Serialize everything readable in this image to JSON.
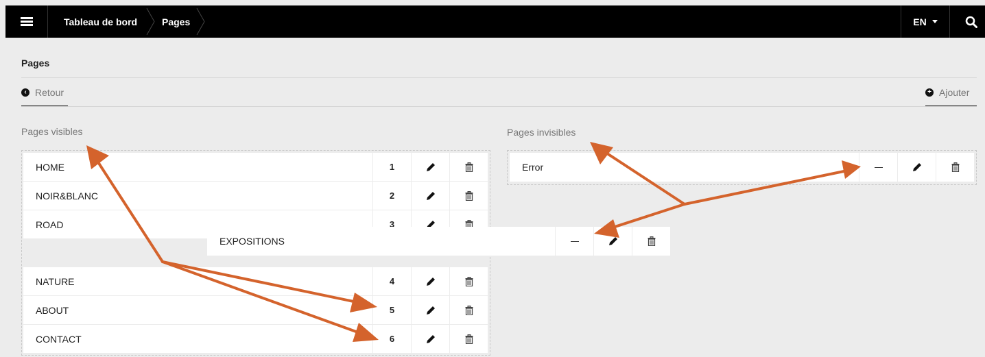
{
  "topbar": {
    "breadcrumb": [
      {
        "label": "Tableau de bord"
      },
      {
        "label": "Pages"
      }
    ],
    "language": "EN"
  },
  "page": {
    "title": "Pages",
    "back_label": "Retour",
    "add_label": "Ajouter"
  },
  "visible_section": {
    "title": "Pages visibles",
    "rows": [
      {
        "label": "HOME",
        "order": "1"
      },
      {
        "label": "NOIR&BLANC",
        "order": "2"
      },
      {
        "label": "ROAD",
        "order": "3"
      },
      {
        "label": "NATURE",
        "order": "4"
      },
      {
        "label": "ABOUT",
        "order": "5"
      },
      {
        "label": "CONTACT",
        "order": "6"
      }
    ]
  },
  "invisible_section": {
    "title": "Pages invisibles",
    "rows": [
      {
        "label": "Error"
      }
    ]
  },
  "dragged_row": {
    "label": "EXPOSITIONS"
  },
  "colors": {
    "accent_arrow": "#d4632c",
    "topbar": "#000000"
  }
}
